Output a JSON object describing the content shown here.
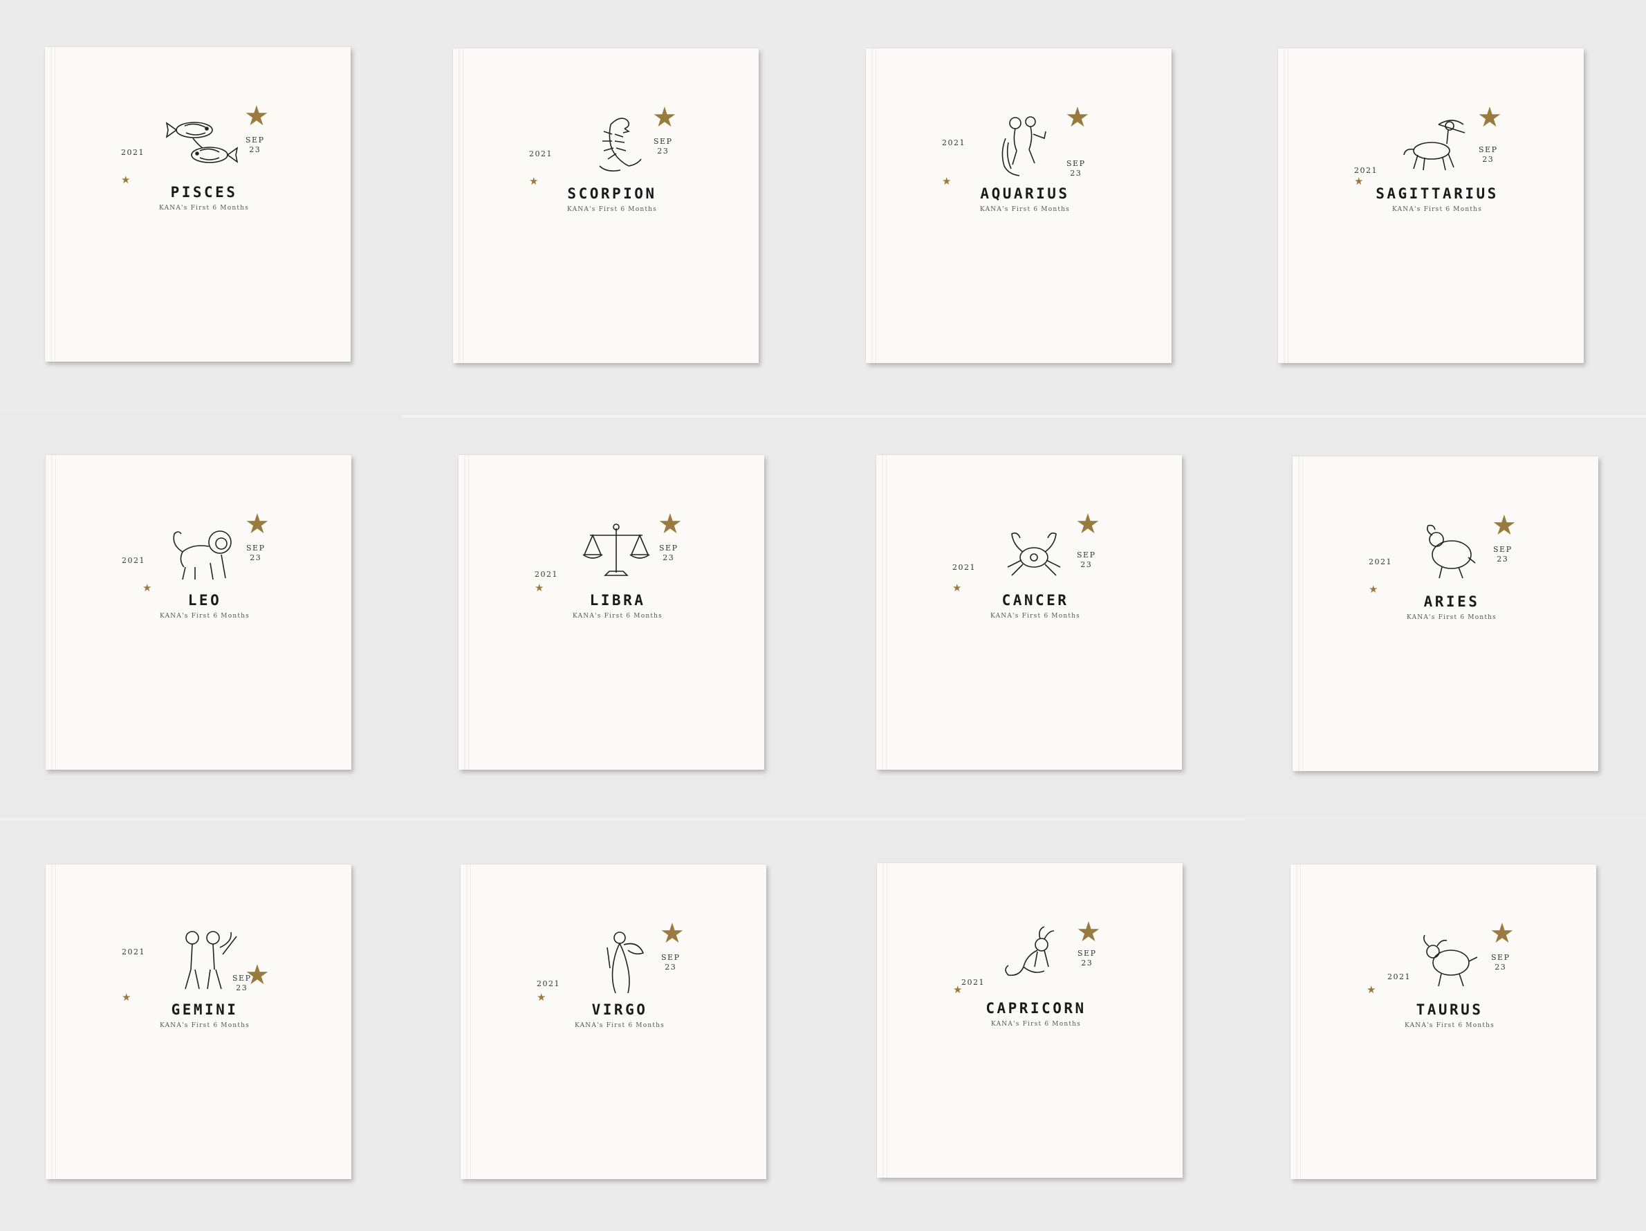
{
  "books": [
    {
      "sign": "PISCES",
      "year": "2021",
      "month": "SEP",
      "day": "23",
      "subtitle": "KANA's First 6 Months",
      "icon": "pisces-fish-icon"
    },
    {
      "sign": "SCORPION",
      "year": "2021",
      "month": "SEP",
      "day": "23",
      "subtitle": "KANA's First 6 Months",
      "icon": "scorpion-icon"
    },
    {
      "sign": "AQUARIUS",
      "year": "2021",
      "month": "SEP",
      "day": "23",
      "subtitle": "KANA's First 6 Months",
      "icon": "aquarius-water-bearer-icon"
    },
    {
      "sign": "SAGITTARIUS",
      "year": "2021",
      "month": "SEP",
      "day": "23",
      "subtitle": "KANA's First 6 Months",
      "icon": "sagittarius-centaur-icon"
    },
    {
      "sign": "LEO",
      "year": "2021",
      "month": "SEP",
      "day": "23",
      "subtitle": "KANA's First 6 Months",
      "icon": "leo-lion-icon"
    },
    {
      "sign": "LIBRA",
      "year": "2021",
      "month": "SEP",
      "day": "23",
      "subtitle": "KANA's First 6 Months",
      "icon": "libra-scales-icon"
    },
    {
      "sign": "CANCER",
      "year": "2021",
      "month": "SEP",
      "day": "23",
      "subtitle": "KANA's First 6 Months",
      "icon": "cancer-crab-icon"
    },
    {
      "sign": "ARIES",
      "year": "2021",
      "month": "SEP",
      "day": "23",
      "subtitle": "KANA's First 6 Months",
      "icon": "aries-ram-icon"
    },
    {
      "sign": "GEMINI",
      "year": "2021",
      "month": "SEP",
      "day": "23",
      "subtitle": "KANA's First 6 Months",
      "icon": "gemini-twins-icon"
    },
    {
      "sign": "VIRGO",
      "year": "2021",
      "month": "SEP",
      "day": "23",
      "subtitle": "KANA's First 6 Months",
      "icon": "virgo-maiden-icon"
    },
    {
      "sign": "CAPRICORN",
      "year": "2021",
      "month": "SEP",
      "day": "23",
      "subtitle": "KANA's First 6 Months",
      "icon": "capricorn-seagoat-icon"
    },
    {
      "sign": "TAURUS",
      "year": "2021",
      "month": "SEP",
      "day": "23",
      "subtitle": "KANA's First 6 Months",
      "icon": "taurus-bull-icon"
    }
  ],
  "colors": {
    "background": "#ebebeb",
    "cover": "#fbfaf7",
    "star_gold": "#9a7b3f",
    "ink": "#1a1a1a"
  }
}
